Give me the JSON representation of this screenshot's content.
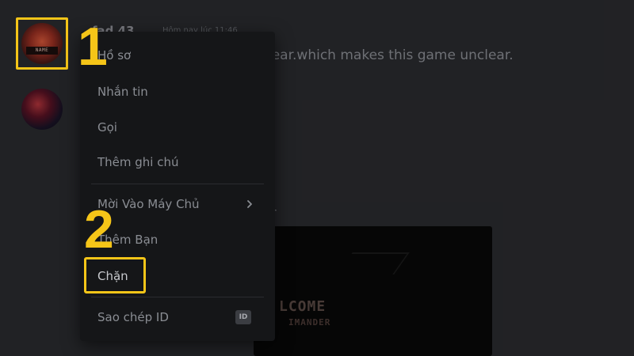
{
  "chat": {
    "username": "fad 43",
    "timestamp": "Hôm nay lúc 11:46",
    "message": "lear.which makes this game unclear.",
    "partial_text": "r",
    "embed": {
      "line1": "LCOME",
      "line2": "IMANDER"
    },
    "avatar_text": "NAME"
  },
  "context_menu": {
    "items": [
      {
        "label": "Hồ sơ"
      },
      {
        "label": "Nhắn tin"
      },
      {
        "label": "Gọi"
      },
      {
        "label": "Thêm ghi chú"
      },
      {
        "label": "Mời Vào Máy Chủ",
        "has_submenu": true
      },
      {
        "label": "Thêm Bạn"
      },
      {
        "label": "Chặn"
      },
      {
        "label": "Sao chép ID",
        "badge": "ID"
      }
    ]
  },
  "annotations": {
    "step1": "1",
    "step2": "2",
    "highlight_color": "#f5c518"
  }
}
